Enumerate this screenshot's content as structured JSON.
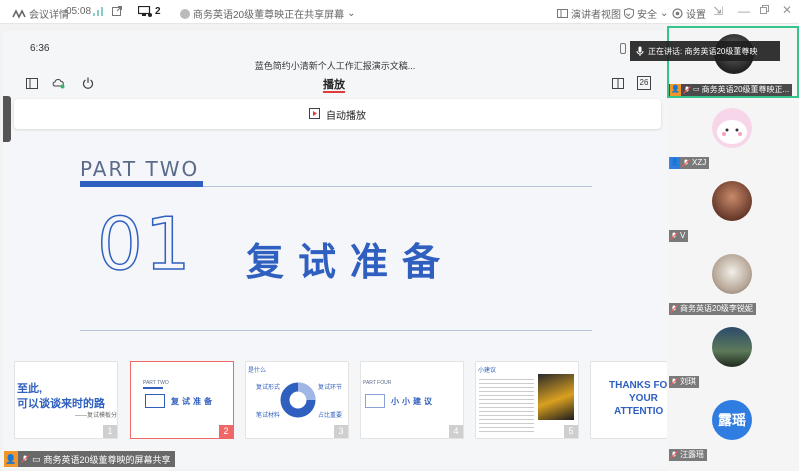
{
  "topbar": {
    "meeting_details": "会议详情",
    "timer": "05:08",
    "participants_count": "2",
    "sharing_status": "商务英语20级董尊映正在共享屏幕",
    "presenter_view": "演讲者视图",
    "security": "安全",
    "settings": "设置"
  },
  "slide_app": {
    "time": "6:36",
    "doc_title": "蓝色简约小清新个人工作汇报演示文稿...",
    "play_tab": "播放",
    "page_indicator": "26",
    "autoplay_label": "自动播放"
  },
  "slide": {
    "part_label": "PART TWO",
    "number": "01",
    "heading": "复试准备"
  },
  "thumbnails": [
    {
      "num": "1",
      "line1": "至此,",
      "line2": "可以谈谈来时的路",
      "line3": "——复试模板分"
    },
    {
      "num": "2",
      "label": "复试准备",
      "part": "PART TWO"
    },
    {
      "num": "3",
      "t1": "复试形式",
      "t2": "复试环节",
      "t3": "笔试材料",
      "t4": "占比重要",
      "t0": "是什么"
    },
    {
      "num": "4",
      "label": "小小建议",
      "part": "PART FOUR"
    },
    {
      "num": "5",
      "t0": "小建议"
    },
    {
      "num": "",
      "line1": "THANKS FO",
      "line2": "YOUR",
      "line3": "ATTENTIO"
    }
  ],
  "footer": {
    "share_label": "商务英语20级董尊映的屏幕共享"
  },
  "speaking_banner": "正在讲话: 商务英语20级董尊映",
  "participants": [
    {
      "name": "商务英语20级董尊映正..."
    },
    {
      "name": "XZJ"
    },
    {
      "name": "V"
    },
    {
      "name": "商务英语20级李锐妮"
    },
    {
      "name": "刘琪"
    },
    {
      "name": "汪露瑶",
      "avatar_text": "露瑶"
    }
  ],
  "colors": {
    "accent_blue": "#2f5fbf",
    "active_green": "#35c58b",
    "play_red": "#e23b3b",
    "selected_thumb": "#f06767"
  }
}
